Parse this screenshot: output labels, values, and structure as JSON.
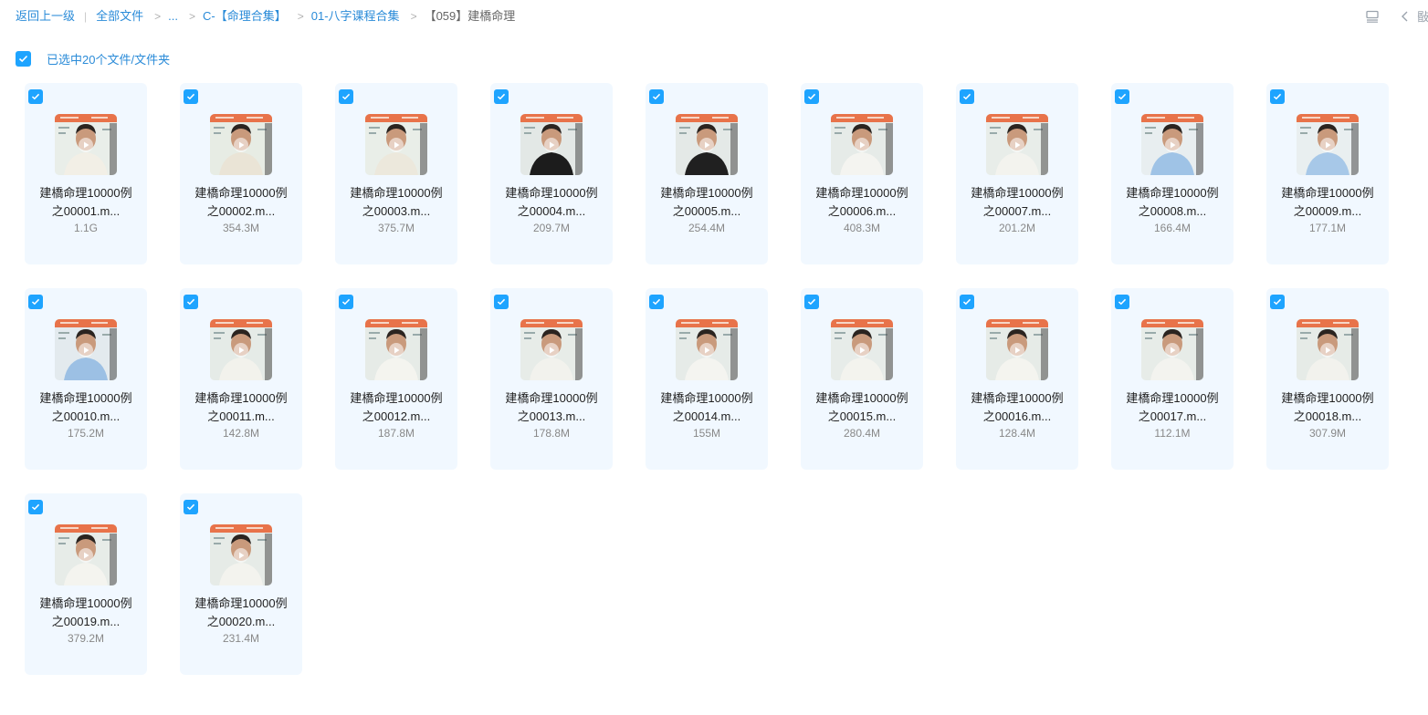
{
  "breadcrumb": {
    "back": "返回上一级",
    "root": "全部文件",
    "ellipsis": "...",
    "level1": "C-【命理合集】",
    "level2": "01-八字课程合集",
    "current": "【059】建橋命理",
    "sep": ">",
    "bar": "|"
  },
  "toolbar": {
    "list_icon": "list-view-icon",
    "back_icon": "chevron-left-icon",
    "clipped_text": "敯"
  },
  "selection": {
    "label": "已选中20个文件/文件夹",
    "checked": true
  },
  "colors": {
    "accent": "#1ea4ff",
    "link": "#2a8bd8",
    "tile_bg": "#f1f8ff"
  },
  "files": [
    {
      "line1": "建橋命理10000例",
      "line2": "之00001.m...",
      "size": "1.1G",
      "shirt": "#f2efe6",
      "bg": "#e9eee9"
    },
    {
      "line1": "建橋命理10000例",
      "line2": "之00002.m...",
      "size": "354.3M",
      "shirt": "#eae4d6",
      "bg": "#e7ece4"
    },
    {
      "line1": "建橋命理10000例",
      "line2": "之00003.m...",
      "size": "375.7M",
      "shirt": "#ece8dc",
      "bg": "#e9eee8"
    },
    {
      "line1": "建橋命理10000例",
      "line2": "之00004.m...",
      "size": "209.7M",
      "shirt": "#1c1c1c",
      "bg": "#e3e8e6"
    },
    {
      "line1": "建橋命理10000例",
      "line2": "之00005.m...",
      "size": "254.4M",
      "shirt": "#202020",
      "bg": "#e4e9e7"
    },
    {
      "line1": "建橋命理10000例",
      "line2": "之00006.m...",
      "size": "408.3M",
      "shirt": "#f4f4f0",
      "bg": "#e6ebe8"
    },
    {
      "line1": "建橋命理10000例",
      "line2": "之00007.m...",
      "size": "201.2M",
      "shirt": "#f3f3ee",
      "bg": "#e8ede9"
    },
    {
      "line1": "建橋命理10000例",
      "line2": "之00008.m...",
      "size": "166.4M",
      "shirt": "#9fc3e6",
      "bg": "#e8eef0"
    },
    {
      "line1": "建橋命理10000例",
      "line2": "之00009.m...",
      "size": "177.1M",
      "shirt": "#a7c8e8",
      "bg": "#e9eff0"
    },
    {
      "line1": "建橋命理10000例",
      "line2": "之00010.m...",
      "size": "175.2M",
      "shirt": "#9cc0e4",
      "bg": "#e3eaee"
    },
    {
      "line1": "建橋命理10000例",
      "line2": "之00011.m...",
      "size": "142.8M",
      "shirt": "#f2f2ec",
      "bg": "#e5ebe7"
    },
    {
      "line1": "建橋命理10000例",
      "line2": "之00012.m...",
      "size": "187.8M",
      "shirt": "#f4f4ef",
      "bg": "#e6ebe7"
    },
    {
      "line1": "建橋命理10000例",
      "line2": "之00013.m...",
      "size": "178.8M",
      "shirt": "#f2f2ed",
      "bg": "#e7ece8"
    },
    {
      "line1": "建橋命理10000例",
      "line2": "之00014.m...",
      "size": "155M",
      "shirt": "#f4f4f0",
      "bg": "#e6ebe8"
    },
    {
      "line1": "建橋命理10000例",
      "line2": "之00015.m...",
      "size": "280.4M",
      "shirt": "#f3f3ee",
      "bg": "#e7ece9"
    },
    {
      "line1": "建橋命理10000例",
      "line2": "之00016.m...",
      "size": "128.4M",
      "shirt": "#f4f4ef",
      "bg": "#e6ebe7"
    },
    {
      "line1": "建橋命理10000例",
      "line2": "之00017.m...",
      "size": "112.1M",
      "shirt": "#f3f3ef",
      "bg": "#e7ece8"
    },
    {
      "line1": "建橋命理10000例",
      "line2": "之00018.m...",
      "size": "307.9M",
      "shirt": "#f2f2ed",
      "bg": "#e6ebe7"
    },
    {
      "line1": "建橋命理10000例",
      "line2": "之00019.m...",
      "size": "379.2M",
      "shirt": "#f4f4ef",
      "bg": "#e7ece8"
    },
    {
      "line1": "建橋命理10000例",
      "line2": "之00020.m...",
      "size": "231.4M",
      "shirt": "#f3f3ee",
      "bg": "#e6ebe7"
    }
  ]
}
